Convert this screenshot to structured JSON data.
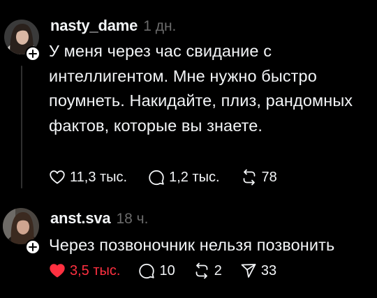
{
  "posts": [
    {
      "username": "nasty_dame",
      "time": "1 дн.",
      "text": "У меня через час свидание с интеллигентом. Мне нужно быстро поумнеть. Накидайте, плиз, рандомных фактов, которые вы знаете.",
      "likes": "11,3 тыс.",
      "replies": "1,2 тыс.",
      "reposts": "78",
      "liked": false,
      "icons": [
        "heart-icon",
        "comment-icon",
        "repost-icon"
      ]
    },
    {
      "username": "anst.sva",
      "time": "18 ч.",
      "text": "Через позвоночник нельзя позвонить",
      "likes": "3,5 тыс.",
      "replies": "10",
      "reposts": "2",
      "shares": "33",
      "liked": true,
      "icons": [
        "heart-filled-icon",
        "comment-icon",
        "repost-icon",
        "share-icon"
      ]
    }
  ],
  "colors": {
    "background": "#000000",
    "text": "#f3f5f7",
    "muted": "#6b6b6b",
    "like_red": "#ff3040",
    "thread_line": "#2f2f2f"
  }
}
